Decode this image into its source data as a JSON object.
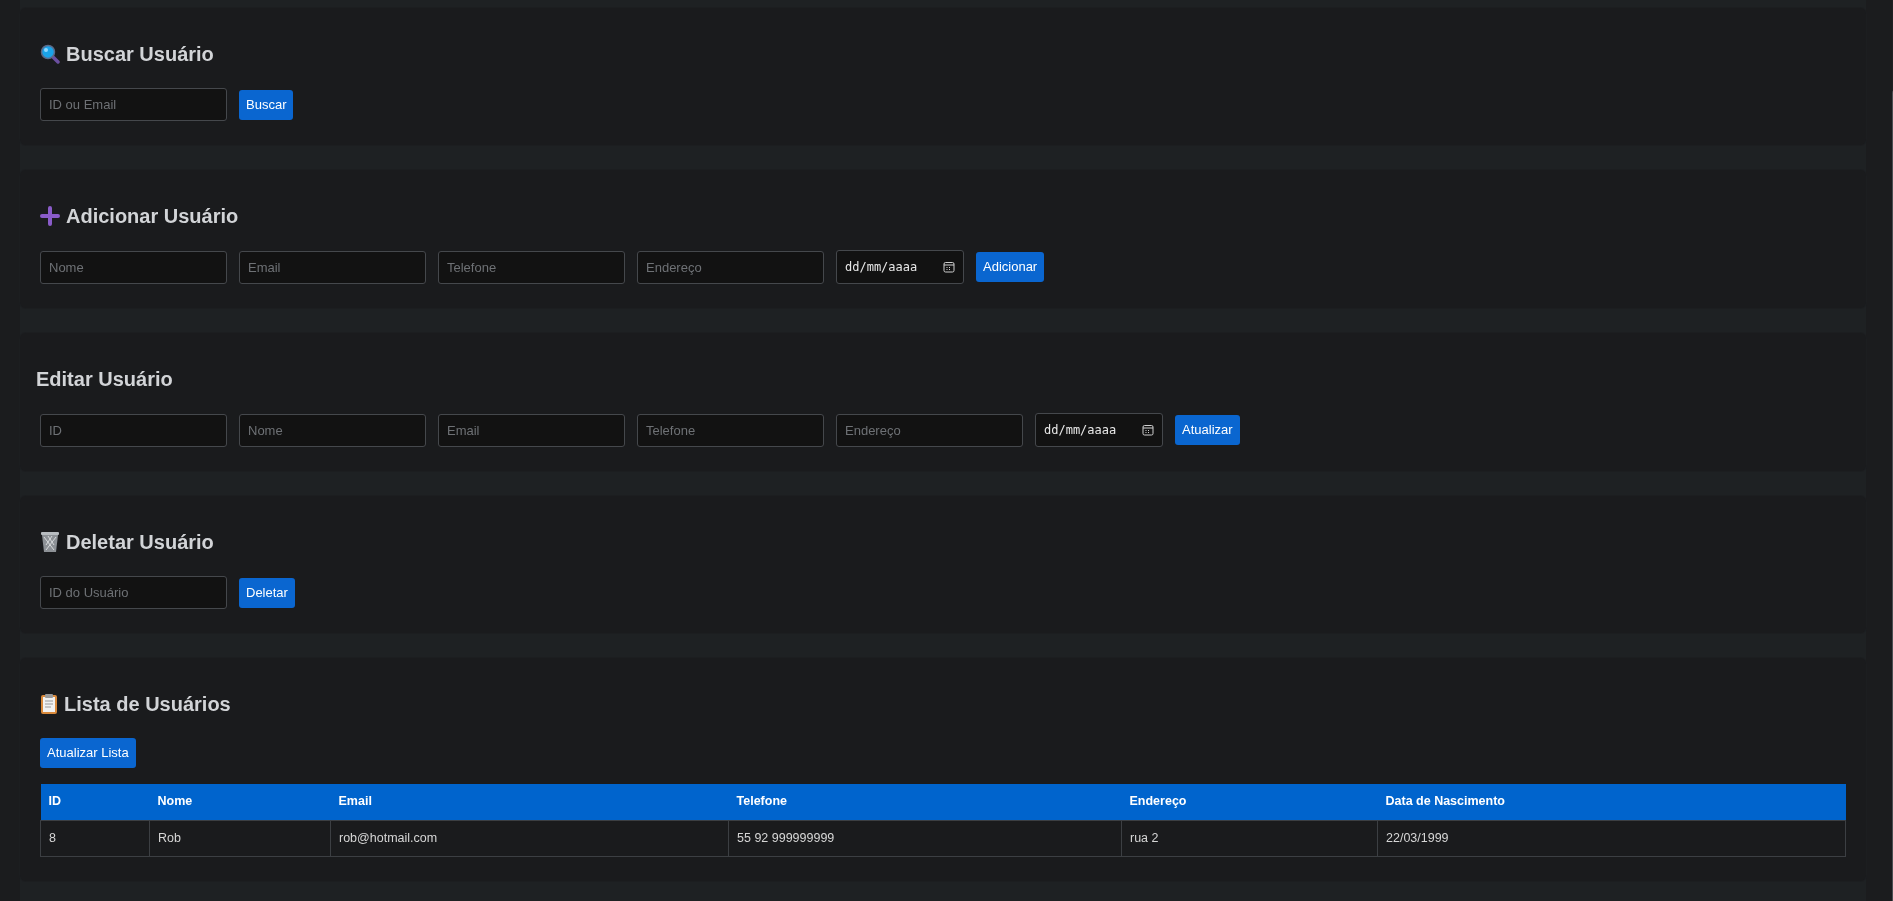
{
  "sections": [
    {
      "kind": "search",
      "title": "Buscar Usuário",
      "fields": [
        {
          "kind": "text",
          "placeholder": "ID ou Email"
        }
      ],
      "button": "Buscar"
    },
    {
      "kind": "add",
      "title": "Adicionar Usuário",
      "fields": [
        {
          "kind": "text",
          "placeholder": "Nome"
        },
        {
          "kind": "text",
          "placeholder": "Email"
        },
        {
          "kind": "text",
          "placeholder": "Telefone"
        },
        {
          "kind": "text",
          "placeholder": "Endereço"
        },
        {
          "kind": "date",
          "placeholder": "dd/mm/aaaa"
        }
      ],
      "button": "Adicionar"
    },
    {
      "kind": "edit",
      "title": "Editar Usuário",
      "fields": [
        {
          "kind": "text",
          "placeholder": "ID"
        },
        {
          "kind": "text",
          "placeholder": "Nome"
        },
        {
          "kind": "text",
          "placeholder": "Email"
        },
        {
          "kind": "text",
          "placeholder": "Telefone"
        },
        {
          "kind": "text",
          "placeholder": "Endereço"
        },
        {
          "kind": "date",
          "placeholder": "dd/mm/aaaa"
        }
      ],
      "button": "Atualizar"
    },
    {
      "kind": "delete",
      "title": "Deletar Usuário",
      "fields": [
        {
          "kind": "text",
          "placeholder": "ID do Usuário"
        }
      ],
      "button": "Deletar"
    },
    {
      "kind": "list",
      "title": "Lista de Usuários",
      "button": "Atualizar Lista",
      "table": {
        "columns": [
          "ID",
          "Nome",
          "Email",
          "Telefone",
          "Endereço",
          "Data de Nascimento"
        ],
        "rows": [
          [
            "8",
            "Rob",
            "rob@hotmail.com",
            "55 92 999999999",
            "rua 2",
            "22/03/1999"
          ]
        ]
      }
    }
  ]
}
